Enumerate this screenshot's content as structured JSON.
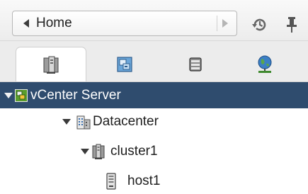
{
  "nav": {
    "back_label": "Home",
    "icons": {
      "back": "back-arrow-icon",
      "forward": "forward-arrow-icon",
      "history": "history-icon",
      "pin": "pin-icon"
    }
  },
  "tabs": [
    {
      "icon": "hosts-clusters-icon",
      "active": true
    },
    {
      "icon": "vms-templates-icon",
      "active": false
    },
    {
      "icon": "storage-icon",
      "active": false
    },
    {
      "icon": "networking-icon",
      "active": false
    }
  ],
  "tree": {
    "items": [
      {
        "label": "vCenter Server",
        "icon": "vcenter-icon",
        "expanded": true,
        "selected": true
      },
      {
        "label": "Datacenter",
        "icon": "datacenter-icon",
        "expanded": true,
        "selected": false
      },
      {
        "label": "cluster1",
        "icon": "cluster-icon",
        "expanded": true,
        "selected": false
      },
      {
        "label": "host1",
        "icon": "host-icon",
        "expanded": false,
        "selected": false
      }
    ]
  },
  "colors": {
    "selected_row": "#2f4c6e",
    "vcenter_icon": "#5a9d2c"
  }
}
